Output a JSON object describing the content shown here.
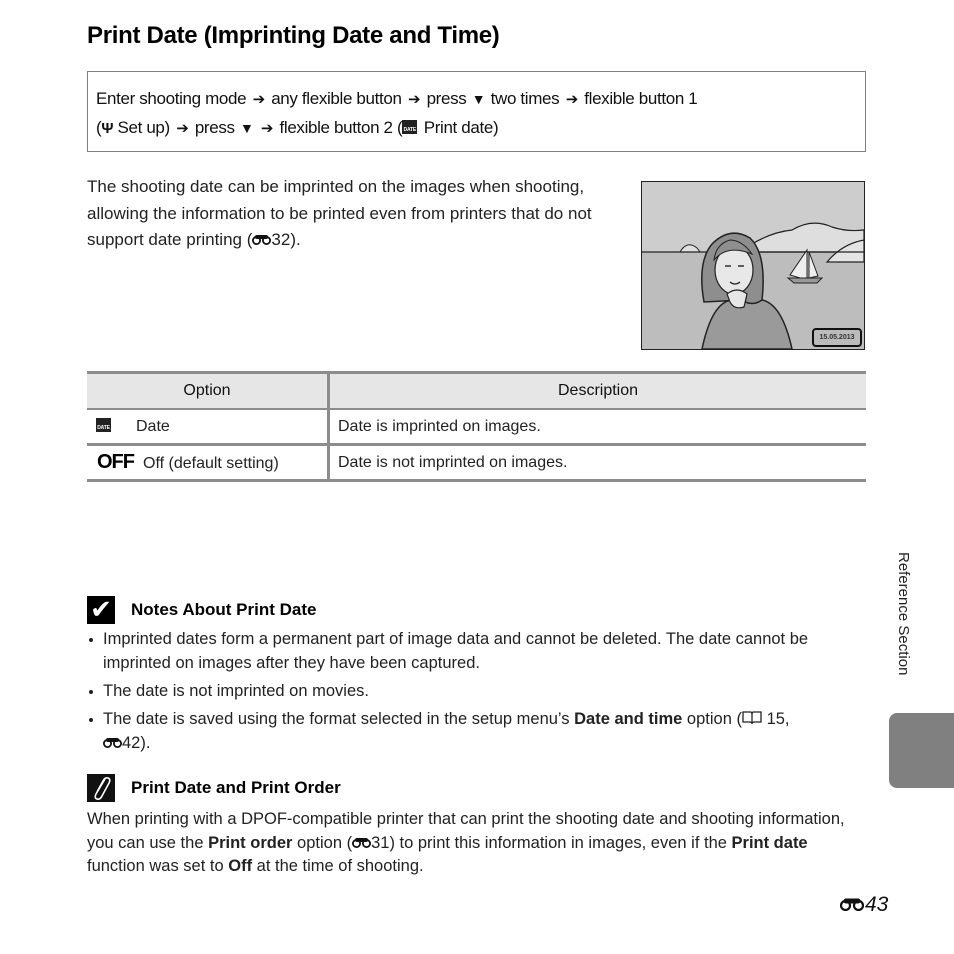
{
  "title": "Print Date (Imprinting Date and Time)",
  "nav": {
    "line1": {
      "t1": "Enter shooting mode",
      "t2": "any flexible button",
      "t3": "press",
      "t4": "two times",
      "t5": "flexible button 1"
    },
    "line2": {
      "t1": "(",
      "t2": "Set up)",
      "t3": "press",
      "t4": "flexible button 2 (",
      "t5": "Print date)"
    },
    "arrow_glyph": "➔",
    "down_glyph": "▼",
    "wrench_glyph": "Ψ",
    "date_icon_text": "DATE"
  },
  "intro": {
    "text": "The shooting date can be imprinted on the images when shooting, allowing the information to be printed even from printers that do not support date printing (",
    "ref": "32",
    "end": ")."
  },
  "photo": {
    "date_stamp": "15.05.2013"
  },
  "table": {
    "headers": [
      "Option",
      "Description"
    ],
    "rows": [
      {
        "icon": "DATE",
        "option": "Date",
        "description": "Date is imprinted on images."
      },
      {
        "icon": "OFF",
        "option": "Off (default setting)",
        "description": "Date is not imprinted on images."
      }
    ]
  },
  "notes": {
    "icon": "✔",
    "heading": "Notes About Print Date",
    "bullets": [
      {
        "text": "Imprinted dates form a permanent part of image data and cannot be deleted. The date cannot be imprinted on images after they have been captured."
      },
      {
        "text": "The date is not imprinted on movies."
      },
      {
        "pre": "The date is saved using the format selected in the setup menu’s ",
        "bold": "Date and time",
        "post": " option (",
        "ref1": "15,",
        "ref2": "42",
        "end": ")."
      }
    ]
  },
  "order": {
    "heading": "Print Date and Print Order",
    "p1": "When printing with a DPOF-compatible printer that can print the shooting date and shooting information, you can use the ",
    "b1": "Print order",
    "p2": " option (",
    "ref": "31",
    "p3": ") to print this information in images, even if the ",
    "b2": "Print date",
    "p4": " function was set to ",
    "b3": "Off",
    "p5": " at the time of shooting."
  },
  "side_tab": {
    "label": "Reference Section",
    "color": "#808080"
  },
  "page_number": "43"
}
